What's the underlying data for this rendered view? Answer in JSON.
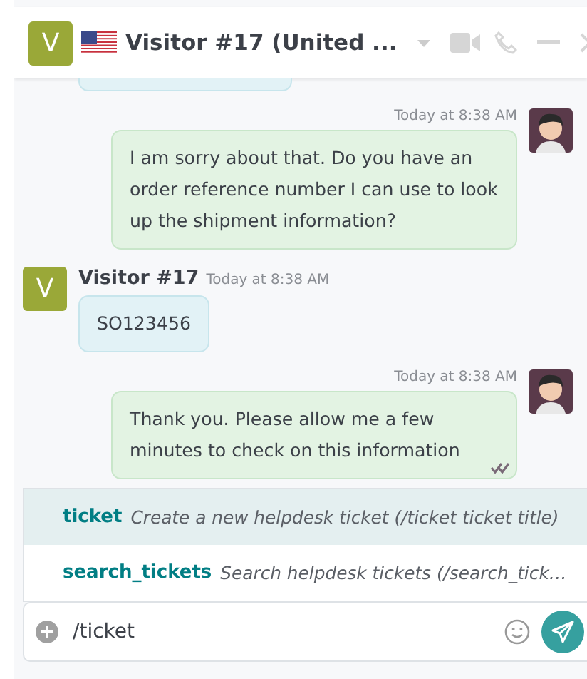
{
  "header": {
    "avatar": "V",
    "title": "Visitor #17 (United ..."
  },
  "messages": [
    {
      "kind": "clipped"
    },
    {
      "kind": "agent",
      "time": "Today at 8:38 AM",
      "text": "I am sorry about that. Do you have an order reference number I can use to look up the shipment information?",
      "seen": false
    },
    {
      "kind": "visitor",
      "author": "Visitor #17",
      "avatar": "V",
      "time": "Today at 8:38 AM",
      "text": "SO123456"
    },
    {
      "kind": "agent",
      "time": "Today at 8:38 AM",
      "text": "Thank you. Please allow me a few minutes to check on this information",
      "seen": true
    }
  ],
  "suggestions": [
    {
      "command": "ticket",
      "description": "Create a new helpdesk ticket (/ticket ticket title)",
      "selected": true
    },
    {
      "command": "search_tickets",
      "description": "Search helpdesk tickets (/search_tick…",
      "selected": false
    }
  ],
  "composer": {
    "value": "/ticket"
  }
}
